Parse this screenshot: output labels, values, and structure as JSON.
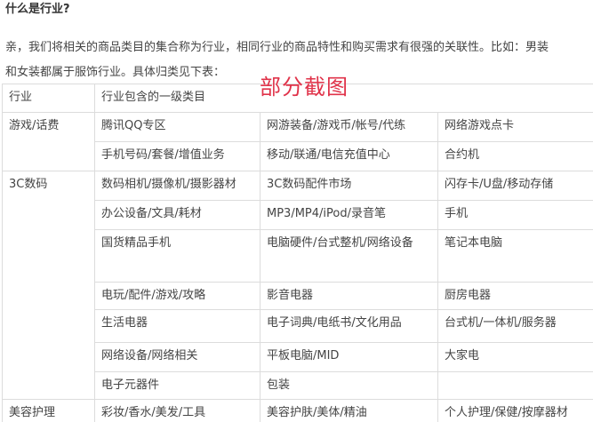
{
  "question": "什么是行业?",
  "intro_lines": [
    "亲，我们将相关的商品类目的集合称为行业，相同行业的商品特性和购买需求有很强的关联性。比如：男装",
    "和女装都属于服饰行业。具体归类见下表："
  ],
  "stamp_text": "部分截图",
  "table": {
    "header": {
      "industry": "行业",
      "categories": "行业包含的一级类目"
    },
    "groups": [
      {
        "industry": "游戏/话费",
        "rows": [
          [
            "腾讯QQ专区",
            "网游装备/游戏币/帐号/代练",
            "网络游戏点卡"
          ],
          [
            "手机号码/套餐/增值业务",
            "移动/联通/电信充值中心",
            "合约机"
          ]
        ]
      },
      {
        "industry": "3C数码",
        "rows": [
          [
            "数码相机/摄像机/摄影器材",
            "3C数码配件市场",
            "闪存卡/U盘/移动存储"
          ],
          [
            "办公设备/文具/耗材",
            "MP3/MP4/iPod/录音笔",
            "手机"
          ],
          [
            "国货精品手机",
            "电脑硬件/台式整机/网络设备",
            "笔记本电脑"
          ],
          [
            "电玩/配件/游戏/攻略",
            "影音电器",
            "厨房电器"
          ],
          [
            "生活电器",
            "电子词典/电纸书/文化用品",
            "台式机/一体机/服务器"
          ],
          [
            "网络设备/网络相关",
            "平板电脑/MID",
            "大家电"
          ],
          [
            "电子元器件",
            "包装",
            ""
          ]
        ]
      },
      {
        "industry": "美容护理",
        "rows": [
          [
            "彩妆/香水/美发/工具",
            "美容护肤/美体/精油",
            "个人护理/保健/按摩器材"
          ]
        ]
      }
    ]
  }
}
